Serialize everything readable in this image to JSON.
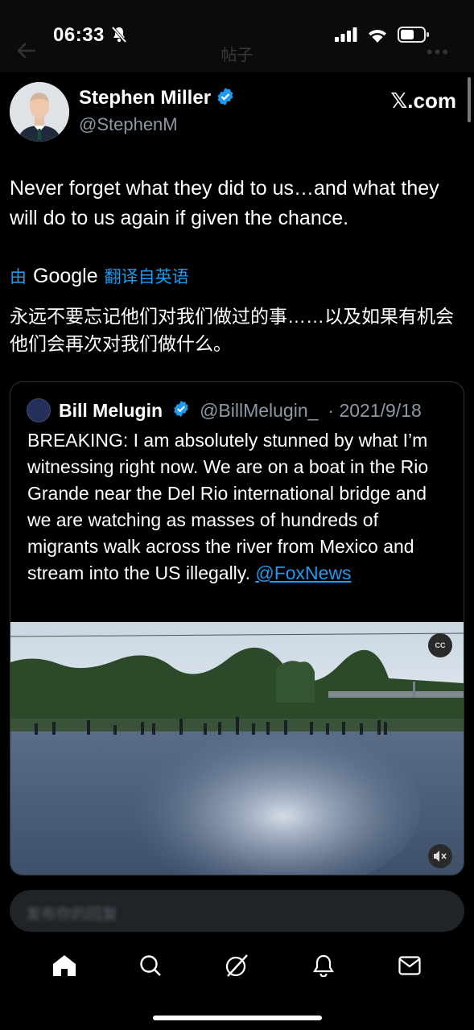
{
  "status_bar": {
    "time": "06:33"
  },
  "nav": {
    "title": "帖子"
  },
  "tweet": {
    "author_name": "Stephen Miller",
    "author_handle": "@StephenM",
    "brand": "𝕏.com",
    "text": "Never forget what they did to us…and what they will do to us again if given the chance.",
    "translation_prefix": "由",
    "translation_provider": "Google",
    "translation_suffix": "翻译自英语",
    "translated_text": "永远不要忘记他们对我们做过的事……以及如果有机会他们会再次对我们做什么。"
  },
  "quote": {
    "author_name": "Bill Melugin",
    "author_handle": "@BillMelugin_",
    "date": "· 2021/9/18",
    "text": "BREAKING: I am absolutely stunned by what I’m witnessing right now. We are on a boat in the Rio Grande near the Del Rio international bridge and we are watching as masses of hundreds of migrants walk across the river from Mexico and stream into the US illegally. ",
    "link": "@FoxNews",
    "cc_label": "CC"
  },
  "reply": {
    "placeholder": "发布你的回复"
  },
  "tabbar": {
    "items": [
      {
        "name": "home",
        "icon": "home-icon"
      },
      {
        "name": "search",
        "icon": "search-icon"
      },
      {
        "name": "grok",
        "icon": "grok-icon"
      },
      {
        "name": "notifications",
        "icon": "bell-icon"
      },
      {
        "name": "messages",
        "icon": "mail-icon"
      }
    ]
  },
  "colors": {
    "accent": "#1d9bf0",
    "background": "#000000",
    "secondary_text": "#8b98a5"
  }
}
